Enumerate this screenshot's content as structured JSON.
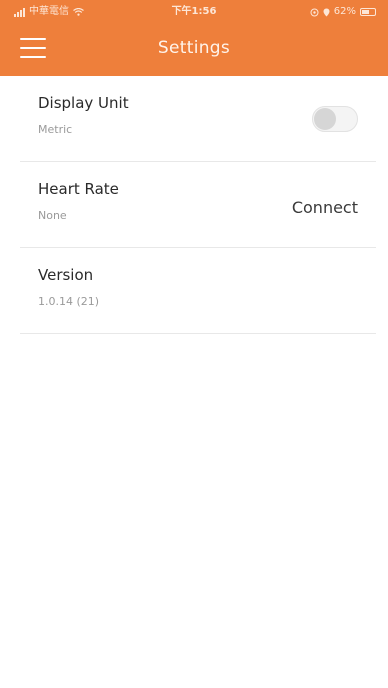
{
  "status_bar": {
    "carrier": "中華電信",
    "time": "下午1:56",
    "battery": "62%",
    "battery_level": 0.62
  },
  "header": {
    "title": "Settings",
    "menu_icon": "hamburger-menu-icon",
    "background_color": "#ee7f3b"
  },
  "settings": {
    "display_unit": {
      "title": "Display Unit",
      "value": "Metric",
      "toggle_on": false
    },
    "heart_rate": {
      "title": "Heart Rate",
      "value": "None",
      "action_label": "Connect"
    },
    "version": {
      "title": "Version",
      "value": "1.0.14 (21)"
    }
  }
}
